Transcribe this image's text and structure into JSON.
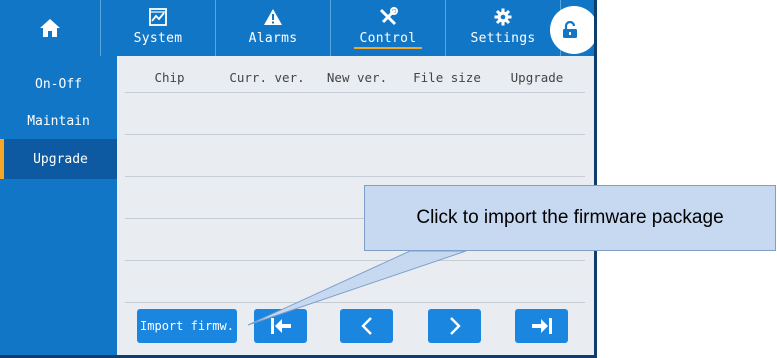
{
  "topbar": {
    "home_icon": "home-icon",
    "tabs": [
      {
        "label": "System",
        "icon": "chart-icon"
      },
      {
        "label": "Alarms",
        "icon": "warning-icon"
      },
      {
        "label": "Control",
        "icon": "tools-icon",
        "active": true
      },
      {
        "label": "Settings",
        "icon": "gear-icon"
      }
    ],
    "lock_icon": "unlock-icon"
  },
  "sidebar": {
    "items": [
      {
        "label": "On-Off"
      },
      {
        "label": "Maintain"
      },
      {
        "label": "Upgrade",
        "active": true
      }
    ]
  },
  "table": {
    "columns": [
      "Chip",
      "Curr. ver.",
      "New ver.",
      "File size",
      "Upgrade"
    ],
    "rows": []
  },
  "buttons": {
    "import_label": "Import firmw.",
    "first_icon": "first-page-icon",
    "prev_icon": "previous-page-icon",
    "next_icon": "next-page-icon",
    "last_icon": "last-page-icon"
  },
  "callout": {
    "text": "Click to import the firmware package"
  },
  "colors": {
    "primary": "#1276c7",
    "accent": "#f5a623",
    "button": "#1a86e0",
    "content_bg": "#e9edf2",
    "callout_bg": "#c6d9f1"
  }
}
